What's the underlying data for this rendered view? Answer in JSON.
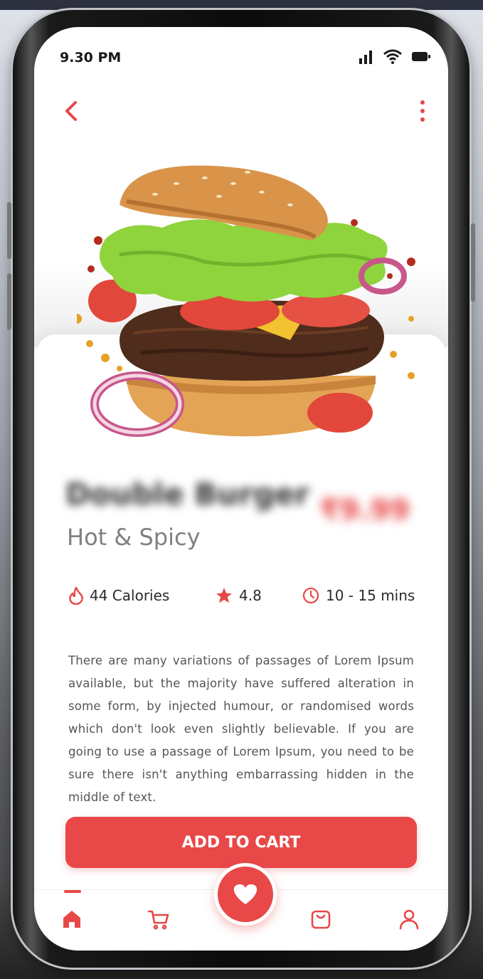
{
  "status_bar": {
    "time": "9.30 PM"
  },
  "product": {
    "name": "Double Burger",
    "price": "₹9.99",
    "subtitle": "Hot & Spicy",
    "description": "There are many variations of passages of Lorem Ipsum available, but the majority have suffered alteration in some form, by injected humour, or randomised words which don't look even slightly believable.  If you are going to use a passage of Lorem Ipsum, you need to be sure there isn't anything embarrassing hidden in the middle of text."
  },
  "stats": {
    "calories": "44 Calories",
    "rating": "4.8",
    "time": "10 - 15 mins"
  },
  "actions": {
    "add_to_cart": "ADD TO CART"
  },
  "icons": {
    "back": "chevron-left-icon",
    "more": "more-vertical-icon",
    "fire": "fire-icon",
    "star": "star-icon",
    "clock": "clock-icon",
    "favorite": "heart-icon",
    "nav": [
      "home-icon",
      "cart-icon",
      "bag-icon",
      "user-icon"
    ]
  },
  "colors": {
    "accent": "#e84848",
    "text": "#2a2a2a",
    "muted": "#808080"
  }
}
